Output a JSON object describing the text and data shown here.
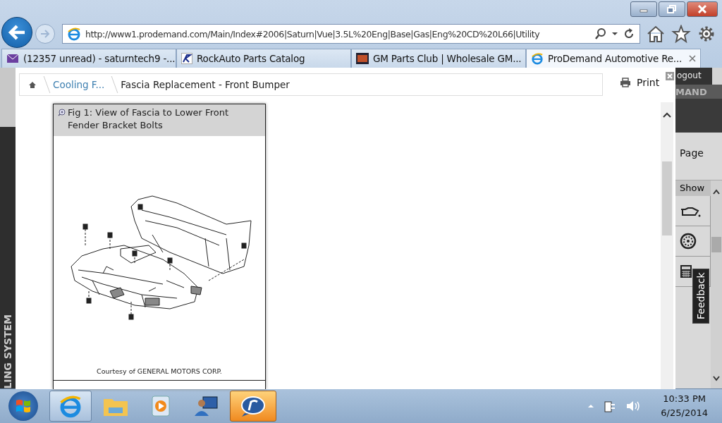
{
  "browser": {
    "address": "http://www1.prodemand.com/Main/Index#2006|Saturn|Vue|3.5L%20Eng|Base|Gas|Eng%20CD%20L66|Utility",
    "tabs": [
      {
        "label": "(12357 unread) - saturntech9 -...",
        "kind": "mail",
        "selected": false
      },
      {
        "label": "RockAuto Parts Catalog",
        "kind": "rockauto",
        "selected": false
      },
      {
        "label": "GM Parts Club | Wholesale GM...",
        "kind": "gm",
        "selected": false
      },
      {
        "label": "ProDemand Automotive Re...",
        "kind": "ie",
        "selected": true
      }
    ]
  },
  "site": {
    "logout": "ogout",
    "brand": "MAND",
    "page_link": "Page",
    "show": "Show",
    "section": "LING SYSTEM",
    "feedback": "Feedback"
  },
  "modal": {
    "breadcrumb": [
      {
        "label": "Cooling F...",
        "link": true
      },
      {
        "label": "Fascia Replacement - Front Bumper",
        "link": false
      }
    ],
    "print": "Print",
    "figure": {
      "caption": "Fig 1: View of Fascia to Lower Front Fender Bracket Bolts",
      "credit": "Courtesy of GENERAL MOTORS CORP."
    }
  },
  "taskbar": {
    "apps": [
      {
        "kind": "ie",
        "active": true,
        "alert": false
      },
      {
        "kind": "folder",
        "active": false,
        "alert": false
      },
      {
        "kind": "media",
        "active": false,
        "alert": false
      },
      {
        "kind": "remote",
        "active": false,
        "alert": false
      },
      {
        "kind": "realplayer",
        "active": false,
        "alert": true
      }
    ],
    "time": "10:33 PM",
    "date": "6/25/2014"
  }
}
